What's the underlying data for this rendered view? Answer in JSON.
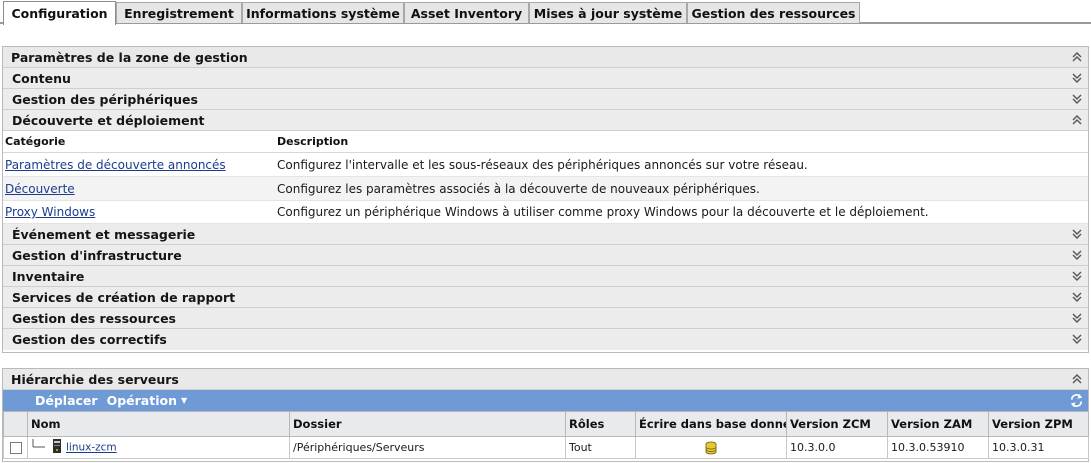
{
  "tabs": [
    {
      "label": "Configuration",
      "active": true
    },
    {
      "label": "Enregistrement",
      "active": false
    },
    {
      "label": "Informations système",
      "active": false
    },
    {
      "label": "Asset Inventory",
      "active": false
    },
    {
      "label": "Mises à jour système",
      "active": false
    },
    {
      "label": "Gestion des ressources",
      "active": false
    }
  ],
  "zone": {
    "title": "Paramètres de la zone de gestion",
    "groups_before": [
      {
        "label": "Contenu",
        "state": "collapsed"
      },
      {
        "label": "Gestion des périphériques",
        "state": "collapsed"
      }
    ],
    "expanded_group": {
      "label": "Découverte et déploiement",
      "state": "expanded",
      "columns": {
        "category": "Catégorie",
        "description": "Description"
      },
      "rows": [
        {
          "category": "Paramètres de découverte annoncés",
          "description": "Configurez l'intervalle et les sous-réseaux des périphériques annoncés sur votre réseau."
        },
        {
          "category": "Découverte",
          "description": "Configurez les paramètres associés à la découverte de nouveaux périphériques."
        },
        {
          "category": "Proxy Windows",
          "description": "Configurez un périphérique Windows à utiliser comme proxy Windows pour la découverte et le déploiement."
        }
      ]
    },
    "groups_after": [
      {
        "label": "Événement et messagerie",
        "state": "collapsed"
      },
      {
        "label": "Gestion d'infrastructure",
        "state": "collapsed"
      },
      {
        "label": "Inventaire",
        "state": "collapsed"
      },
      {
        "label": "Services de création de rapport",
        "state": "collapsed"
      },
      {
        "label": "Gestion des ressources",
        "state": "collapsed"
      },
      {
        "label": "Gestion des correctifs",
        "state": "collapsed"
      }
    ]
  },
  "servers": {
    "title": "Hiérarchie des serveurs",
    "toolbar": {
      "move": "Déplacer",
      "operation": "Opération"
    },
    "columns": {
      "name": "Nom",
      "folder": "Dossier",
      "roles": "Rôles",
      "write_db": "Écrire dans base données",
      "zcm": "Version ZCM",
      "zam": "Version ZAM",
      "zpm": "Version ZPM"
    },
    "rows": [
      {
        "name": "linux-zcm",
        "folder": "/Périphériques/Serveurs",
        "roles": "Tout",
        "zcm": "10.3.0.0",
        "zam": "10.3.0.53910",
        "zpm": "10.3.0.31"
      }
    ]
  },
  "icons": {
    "expanded": "chevron-double-up-icon",
    "collapsed": "chevron-double-down-icon",
    "server": "server-icon",
    "database": "database-icon",
    "refresh": "refresh-icon"
  },
  "colors": {
    "toolbar_blue": "#6f9ad6",
    "link": "#1b3c8f",
    "header_gray": "#ececec"
  }
}
